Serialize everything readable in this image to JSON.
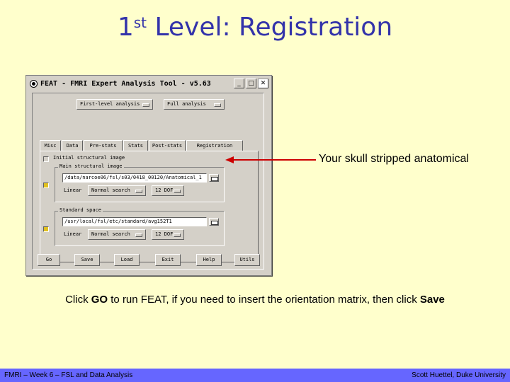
{
  "slide": {
    "title_main": "1",
    "title_sup": "st",
    "title_rest": " Level: Registration",
    "annotation": "Your skull stripped anatomical",
    "caption_p1": "Click ",
    "caption_go": "GO",
    "caption_p2": " to run FEAT, if you need to insert the orientation matrix, then click ",
    "caption_save": "Save",
    "footer_left": "FMRI – Week 6 – FSL and Data Analysis",
    "footer_right": "Scott Huettel, Duke University"
  },
  "window": {
    "title": "FEAT - FMRI Expert Analysis Tool - v5.63",
    "minimize_label": "_",
    "maximize_label": "□",
    "close_label": "✕",
    "menu_analysis_level": "First-level analysis",
    "menu_analysis_type": "Full analysis",
    "tabs": [
      "Misc",
      "Data",
      "Pre-stats",
      "Stats",
      "Post-stats",
      "Registration"
    ],
    "initial_structural_label": "Initial structural image",
    "main_structural": {
      "title": "Main structural image",
      "path": "/data/narcoe06/fsl/s03/0418_00120/Anatomical_1",
      "linear_label": "Linear",
      "search": "Normal search",
      "dof": "12 DOF"
    },
    "standard_space": {
      "title": "Standard space",
      "path": "/usr/local/fsl/etc/standard/avg152T1",
      "linear_label": "Linear",
      "search": "Normal search",
      "dof": "12 DOF"
    },
    "buttons": {
      "go": "Go",
      "save": "Save",
      "load": "Load",
      "exit": "Exit",
      "help": "Help",
      "utils": "Utils"
    }
  },
  "colors": {
    "background": "#ffffcc",
    "title": "#3333aa",
    "arrow": "#cc0000",
    "footer": "#6666ff"
  }
}
